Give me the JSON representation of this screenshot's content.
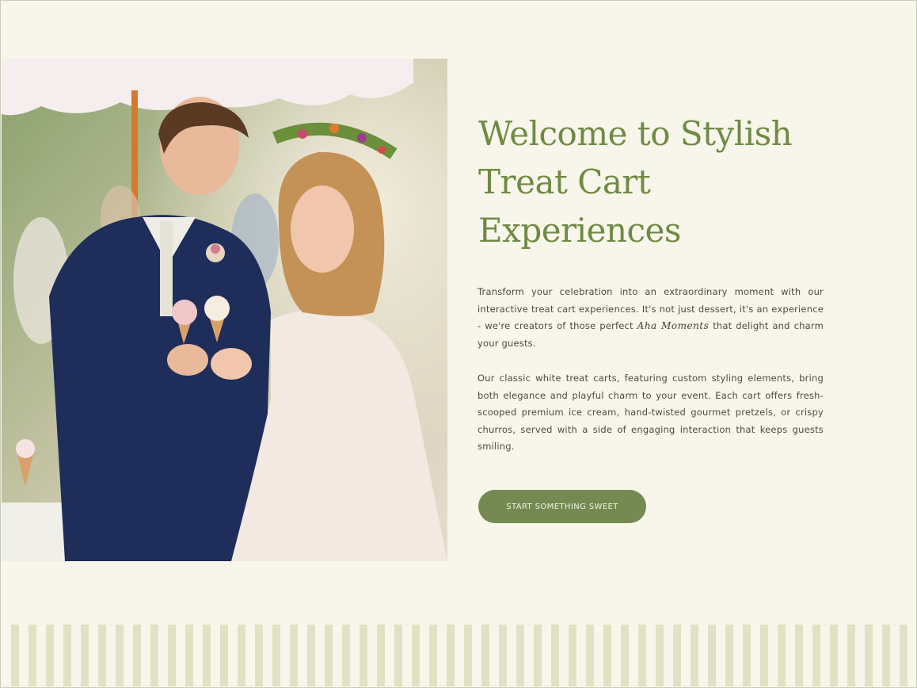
{
  "hero": {
    "image_alt": "Bride and groom sharing ice cream cones at a treat cart",
    "heading_line1": "Welcome to Stylish",
    "heading_line2": "Treat Cart",
    "heading_line3": "Experiences",
    "paragraph1_start": "Transform your celebration into an extraordinary moment with our interactive treat cart experiences. It's not just dessert, it's an experience - we're creators of those perfect ",
    "paragraph1_script": "Aha Moments",
    "paragraph1_end": " that delight and charm your guests.",
    "paragraph2": "Our classic white treat carts, featuring custom styling elements, bring both elegance and playful charm to your event. Each cart offers fresh-scooped premium ice cream, hand-twisted gourmet pretzels, or crispy churros, served with a side of engaging interaction that keeps guests smiling.",
    "cta_label": "START SOMETHING SWEET"
  },
  "colors": {
    "background": "#f8f6ea",
    "heading": "#6f8a45",
    "button": "#758a52",
    "stripe": "#dfe3c4"
  }
}
